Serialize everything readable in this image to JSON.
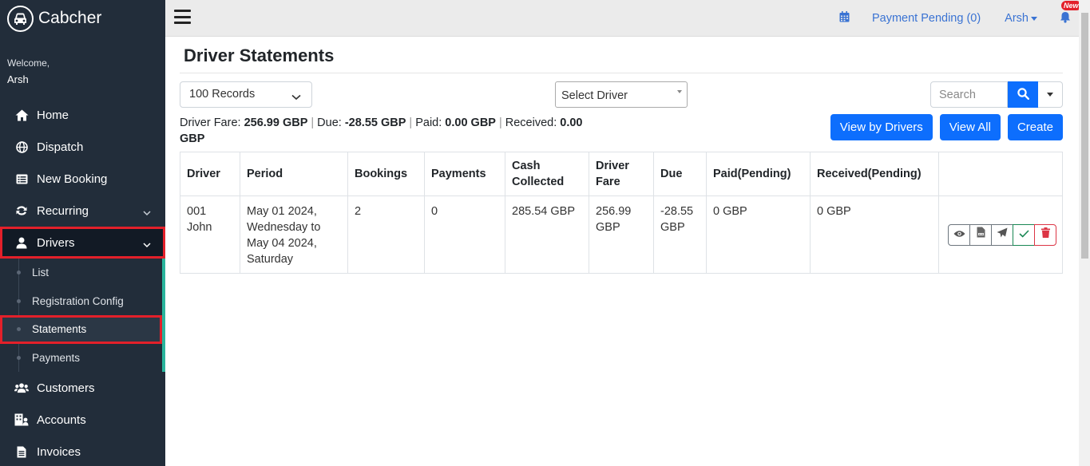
{
  "sidebar": {
    "brand": "Cabcher",
    "welcome": "Welcome,",
    "username": "Arsh",
    "items": [
      {
        "label": "Home"
      },
      {
        "label": "Dispatch"
      },
      {
        "label": "New Booking"
      },
      {
        "label": "Recurring"
      },
      {
        "label": "Drivers"
      },
      {
        "label": "Customers"
      },
      {
        "label": "Accounts"
      },
      {
        "label": "Invoices"
      }
    ],
    "driver_sub": [
      {
        "label": "List"
      },
      {
        "label": "Registration Config"
      },
      {
        "label": "Statements"
      },
      {
        "label": "Payments"
      }
    ]
  },
  "topbar": {
    "payment_pending": "Payment Pending (0)",
    "user": "Arsh",
    "new_badge": "New"
  },
  "page": {
    "title": "Driver Statements",
    "records": "100 Records",
    "driver_placeholder": "Select Driver",
    "search_placeholder": "Search",
    "summary": {
      "fare_label": "Driver Fare:",
      "fare_value": "256.99 GBP",
      "due_label": "Due:",
      "due_value": "-28.55 GBP",
      "paid_label": "Paid:",
      "paid_value": "0.00 GBP",
      "received_label": "Received:",
      "received_value": "0.00 GBP"
    },
    "buttons": {
      "view_by_drivers": "View by Drivers",
      "view_all": "View All",
      "create": "Create"
    }
  },
  "table": {
    "headers": [
      "Driver",
      "Period",
      "Bookings",
      "Payments",
      "Cash Collected",
      "Driver Fare",
      "Due",
      "Paid(Pending)",
      "Received(Pending)",
      ""
    ],
    "rows": [
      {
        "driver": "001 John",
        "period": "May 01 2024, Wednesday to May 04 2024, Saturday",
        "bookings": "2",
        "payments": "0",
        "cash": "285.54 GBP",
        "fare": "256.99 GBP",
        "due": "-28.55 GBP",
        "paid": "0 GBP",
        "received": "0 GBP"
      }
    ]
  },
  "colors": {
    "sidebar_bg": "#222d3a",
    "primary": "#0d6efd",
    "highlight": "#e3202a",
    "accent": "#2ab59d"
  }
}
